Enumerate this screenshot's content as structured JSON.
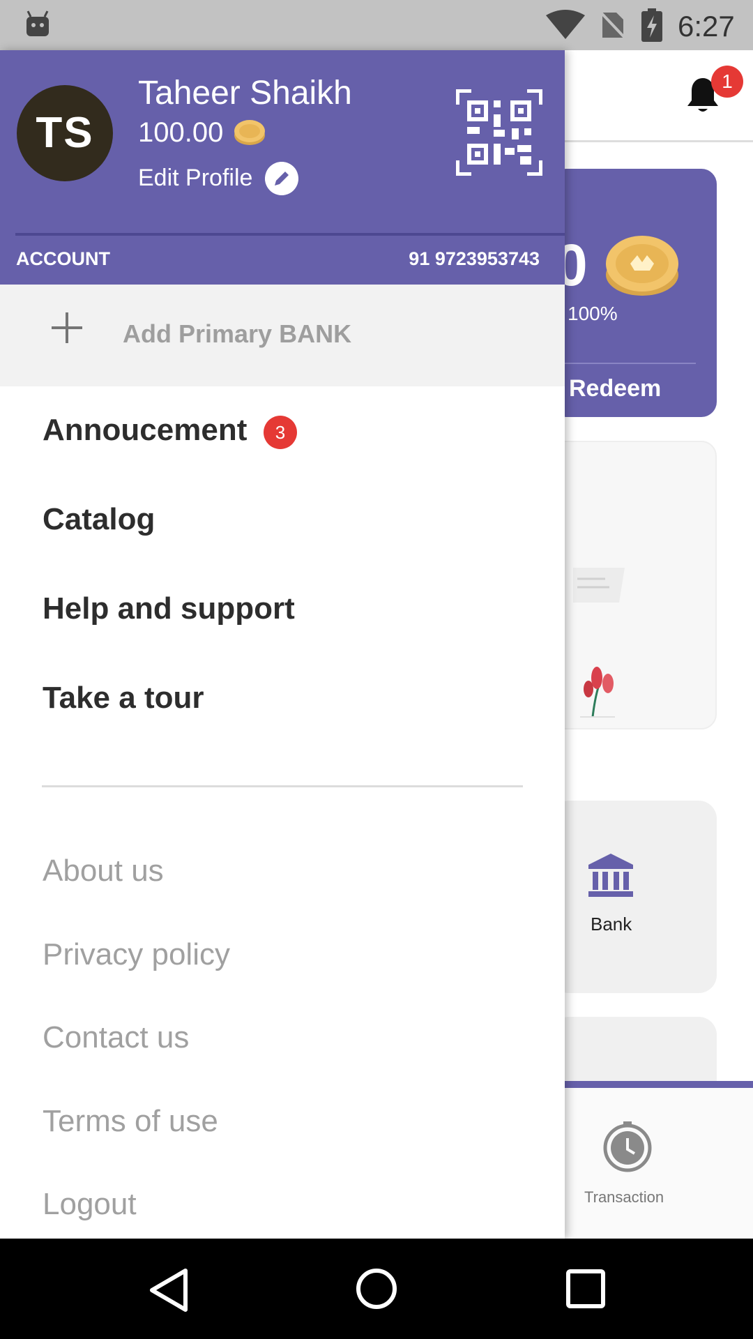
{
  "status_bar": {
    "time": "6:27"
  },
  "background": {
    "notification_count": "1",
    "redeem_label": "Redeem",
    "percent_label": "100%",
    "balance_partial": "0",
    "bank_label": "Bank",
    "transaction_label": "Transaction"
  },
  "drawer": {
    "avatar_initials": "TS",
    "user_name": "Taheer Shaikh",
    "balance": "100.00",
    "edit_profile_label": "Edit Profile",
    "account_label": "ACCOUNT",
    "account_phone": "91 9723953743",
    "add_bank_label": "Add Primary BANK",
    "menu": [
      {
        "label": "Annoucement",
        "badge": "3"
      },
      {
        "label": "Catalog"
      },
      {
        "label": "Help and support"
      },
      {
        "label": "Take a tour"
      }
    ],
    "secondary_menu": [
      {
        "label": "About us"
      },
      {
        "label": "Privacy policy"
      },
      {
        "label": "Contact us"
      },
      {
        "label": "Terms of use"
      },
      {
        "label": "Logout"
      }
    ]
  },
  "colors": {
    "primary": "#6660aa",
    "badge": "#e53935",
    "avatar_bg": "#322b1d"
  }
}
